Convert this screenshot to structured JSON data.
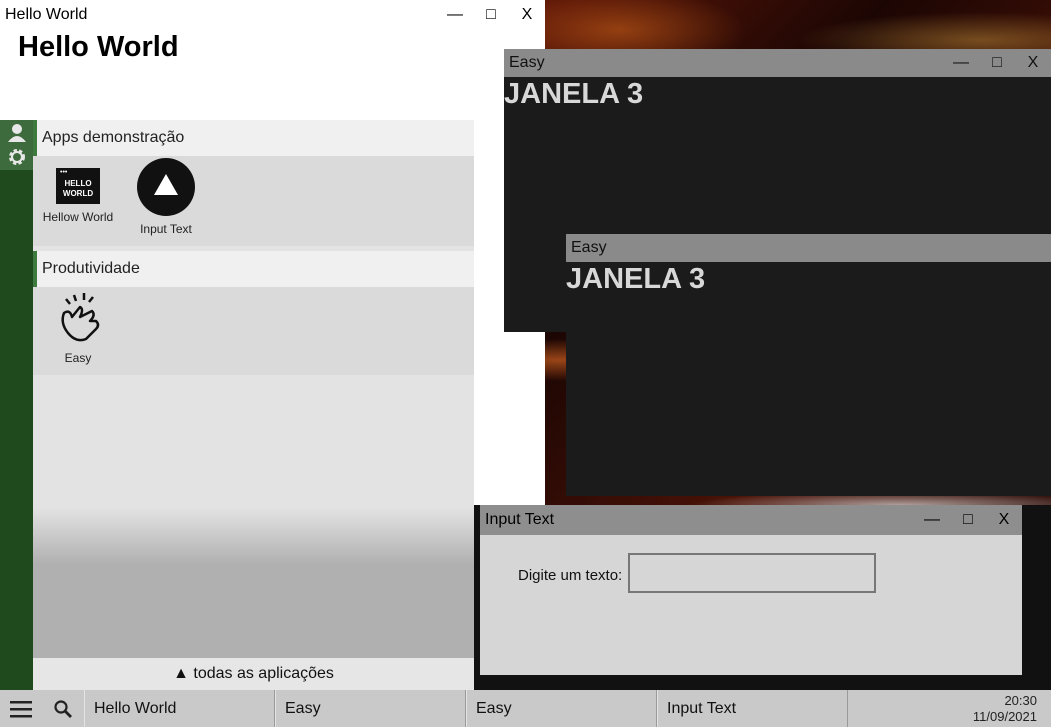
{
  "hello_window": {
    "title": "Hello World",
    "heading": "Hello World",
    "minimize": "—",
    "maximize": "□",
    "close": "X"
  },
  "start_menu": {
    "categories": [
      {
        "name": "Apps demonstração",
        "apps": [
          {
            "label": "Hellow World",
            "icon_text": "HELLO WORLD"
          },
          {
            "label": "Input Text"
          }
        ]
      },
      {
        "name": "Produtividade",
        "apps": [
          {
            "label": "Easy"
          }
        ]
      }
    ],
    "all_apps": "▲ todas as aplicações"
  },
  "easy_windows": [
    {
      "title": "Easy",
      "heading": "JANELA 3",
      "minimize": "—",
      "maximize": "□",
      "close": "X"
    },
    {
      "title": "Easy",
      "heading": "JANELA 3"
    }
  ],
  "input_window": {
    "title": "Input Text",
    "prompt": "Digite um texto:",
    "value": "",
    "minimize": "—",
    "maximize": "□",
    "close": "X"
  },
  "taskbar": {
    "items": [
      "Hello World",
      "Easy",
      "Easy",
      "Input Text"
    ],
    "time": "20:30",
    "date": "11/09/2021"
  },
  "colors": {
    "rail": "#1e4a1e",
    "accent": "#3d7a3d",
    "taskbar": "#c9c9c9"
  }
}
